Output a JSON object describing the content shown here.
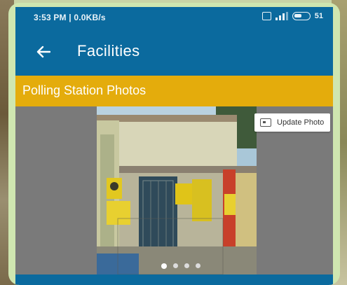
{
  "status_bar": {
    "time_speed": "3:53 PM | 0.0KB/s",
    "battery": "51"
  },
  "app_bar": {
    "back_icon": "arrow-left-icon",
    "title": "Facilities"
  },
  "section": {
    "title": "Polling Station Photos"
  },
  "photo_viewer": {
    "update_button_label": "Update Photo",
    "update_icon": "image-icon",
    "page_count": 4,
    "active_page": 1
  },
  "colors": {
    "primary": "#0b6a9e",
    "accent": "#e4ac0c"
  }
}
